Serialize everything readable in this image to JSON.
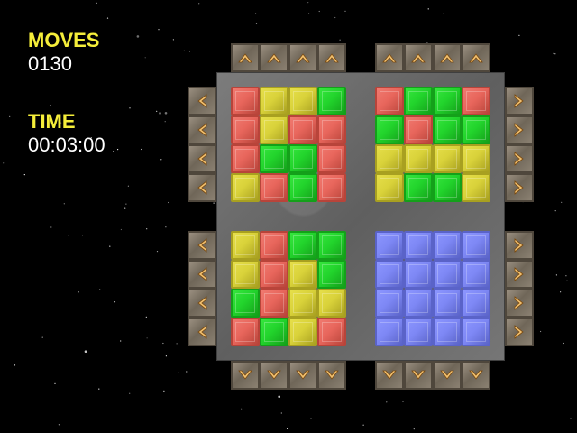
{
  "hud": {
    "moves_label": "MOVES",
    "moves_value": "0130",
    "time_label": "TIME",
    "time_value": "00:03:00"
  },
  "colors": {
    "R": "#e8665c",
    "Y": "#d9d23a",
    "G": "#22d42c",
    "B": "#7e88f5",
    "hud_label": "#f5ee3a",
    "hud_value": "#ffffff"
  },
  "quadrants": {
    "top_left": [
      [
        "R",
        "Y",
        "Y",
        "G"
      ],
      [
        "R",
        "Y",
        "R",
        "R"
      ],
      [
        "R",
        "G",
        "G",
        "R"
      ],
      [
        "Y",
        "R",
        "G",
        "R"
      ]
    ],
    "top_right": [
      [
        "R",
        "G",
        "G",
        "R"
      ],
      [
        "G",
        "R",
        "G",
        "G"
      ],
      [
        "Y",
        "Y",
        "Y",
        "Y"
      ],
      [
        "Y",
        "G",
        "G",
        "Y"
      ]
    ],
    "bottom_left": [
      [
        "Y",
        "R",
        "G",
        "G"
      ],
      [
        "Y",
        "R",
        "Y",
        "G"
      ],
      [
        "G",
        "R",
        "Y",
        "Y"
      ],
      [
        "R",
        "G",
        "Y",
        "R"
      ]
    ],
    "bottom_right": [
      [
        "B",
        "B",
        "B",
        "B"
      ],
      [
        "B",
        "B",
        "B",
        "B"
      ],
      [
        "B",
        "B",
        "B",
        "B"
      ],
      [
        "B",
        "B",
        "B",
        "B"
      ]
    ]
  },
  "arrows": {
    "up_icon": "arrow-up-icon",
    "down_icon": "arrow-down-icon",
    "left_icon": "arrow-left-icon",
    "right_icon": "arrow-right-icon"
  }
}
